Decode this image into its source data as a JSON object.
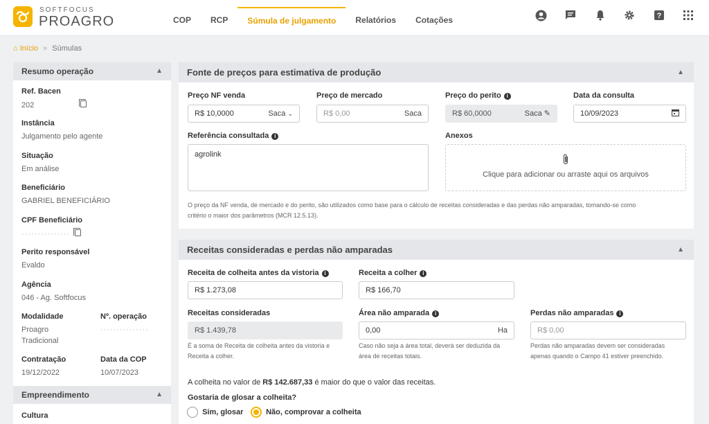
{
  "brand": {
    "top": "SOFTFOCUS",
    "main": "PROAGRO"
  },
  "nav": [
    "COP",
    "RCP",
    "Súmula de julgamento",
    "Relatórios",
    "Cotações"
  ],
  "breadcrumb": {
    "home": "Início",
    "sep": "»",
    "current": "Súmulas"
  },
  "sidebar": {
    "resumo_title": "Resumo operação",
    "empreendimento_title": "Empreendimento",
    "fields": {
      "ref_bacen": {
        "label": "Ref. Bacen",
        "value": "202"
      },
      "instancia": {
        "label": "Instância",
        "value": "Julgamento pelo agente"
      },
      "situacao": {
        "label": "Situação",
        "value": "Em análise"
      },
      "beneficiario": {
        "label": "Beneficiário",
        "value": "GABRIEL BENEFICIÁRIO"
      },
      "cpf": {
        "label": "CPF Beneficiário",
        "value": "···············"
      },
      "perito": {
        "label": "Perito responsável",
        "value": "Evaldo"
      },
      "agencia": {
        "label": "Agência",
        "value": "046 - Ag. Softfocus"
      },
      "modalidade": {
        "label": "Modalidade",
        "value1": "Proagro",
        "value2": "Tradicional"
      },
      "noperacao": {
        "label": "Nº. operação",
        "value": "···············"
      },
      "contratacao": {
        "label": "Contratação",
        "value": "19/12/2022"
      },
      "datacop": {
        "label": "Data da COP",
        "value": "10/07/2023"
      },
      "cultura": {
        "label": "Cultura"
      }
    }
  },
  "fonte": {
    "title": "Fonte de preços para estimativa de produção",
    "preco_nf": {
      "label": "Preço NF venda",
      "value": "R$ 10,0000",
      "unit": "Saca"
    },
    "preco_mercado": {
      "label": "Preço de mercado",
      "placeholder": "R$ 0,00",
      "unit": "Saca"
    },
    "preco_perito": {
      "label": "Preço do perito",
      "value": "R$ 60,0000",
      "unit": "Saca"
    },
    "data_consulta": {
      "label": "Data da consulta",
      "value": "10/09/2023"
    },
    "referencia": {
      "label": "Referência consultada",
      "value": "agrolink"
    },
    "anexos": {
      "label": "Anexos",
      "text": "Clique para adicionar ou arraste aqui os arquivos"
    },
    "note_line1": "O preço da NF venda, de mercado e do perito, são utilizados como base para o cálculo de receitas consideradas e das perdas não amparadas, tomando-se como",
    "note_line2": "critério o maior dos parâmetros (MCR 12.5.13)."
  },
  "receitas": {
    "title": "Receitas consideradas e perdas não amparadas",
    "colheita": {
      "label": "Receita de colheita antes da vistoria",
      "value": "R$ 1.273,08"
    },
    "a_colher": {
      "label": "Receita a colher",
      "value": "R$ 166,70"
    },
    "consideradas": {
      "label": "Receitas consideradas",
      "value": "R$ 1.439,78",
      "hint1": "É a soma de Receita de colheita antes da vistoria e",
      "hint2": "Receita a colher."
    },
    "area": {
      "label": "Área não amparada",
      "value": "0,00",
      "unit": "Ha",
      "hint1": "Caso não seja a área total, deverá ser deduzida da",
      "hint2": "área de receitas totais."
    },
    "perdas": {
      "label": "Perdas não amparadas",
      "placeholder": "R$ 0,00",
      "hint1": "Perdas não amparadas devem ser consideradas",
      "hint2": "apenas quando o Campo 41 estiver preenchido."
    },
    "msg_pre": "A colheita no valor de ",
    "msg_amount": "R$ 142.687,33",
    "msg_post": " é maior do que o valor das receitas.",
    "question": "Gostaria de glosar a colheita?",
    "opt_yes": "Sim, glosar",
    "opt_no": "Não, comprovar a colheita"
  },
  "colors": {
    "accent": "#f4b400",
    "header_bg": "#e4e6e9"
  }
}
